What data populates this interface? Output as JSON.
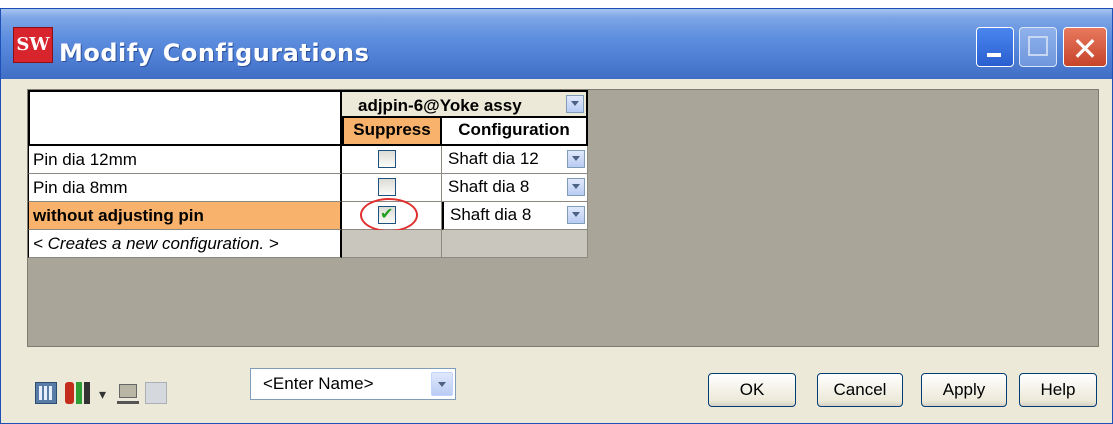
{
  "window": {
    "title": "Modify Configurations",
    "app_logo_text": "SW",
    "colors": {
      "titlebar": "#4f7fd4",
      "selected_row": "#f8b26b",
      "grid_bg": "#a9a699"
    }
  },
  "table": {
    "component_header": "adjpin-6@Yoke assy",
    "columns": [
      "Suppress",
      "Configuration"
    ],
    "rows": [
      {
        "label": "Pin dia 12mm",
        "suppress": false,
        "configuration": "Shaft dia 12"
      },
      {
        "label": "Pin dia 8mm",
        "suppress": false,
        "configuration": "Shaft dia 8"
      },
      {
        "label": "without adjusting pin",
        "suppress": true,
        "configuration": "Shaft dia 8",
        "selected": true
      }
    ],
    "new_row_label": "< Creates a new configuration. >"
  },
  "toolbar": {
    "icons": [
      "table-view-icon",
      "parameters-icon",
      "dropdown-caret-icon",
      "properties-icon",
      "save-table-icon"
    ],
    "name_placeholder": "<Enter Name>"
  },
  "buttons": {
    "ok": "OK",
    "cancel": "Cancel",
    "apply": "Apply",
    "help": "Help"
  }
}
